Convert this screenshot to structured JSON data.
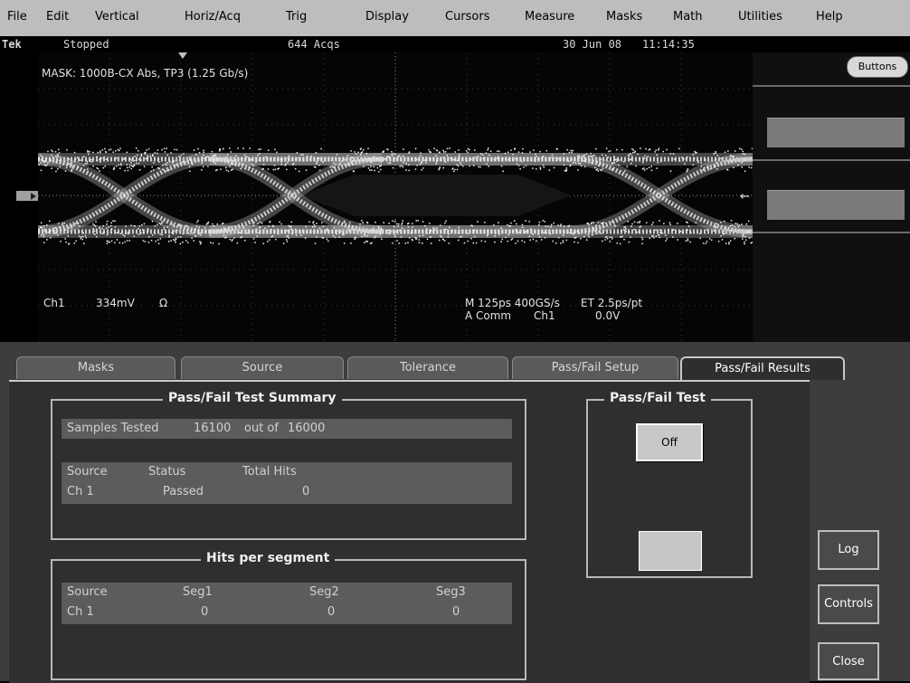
{
  "menu": {
    "items": [
      "File",
      "Edit",
      "Vertical",
      "Horiz/Acq",
      "Trig",
      "Display",
      "Cursors",
      "Measure",
      "Masks",
      "Math",
      "Utilities",
      "Help"
    ]
  },
  "status": {
    "brand": "Tek",
    "state": "Stopped",
    "acqs": "644 Acqs",
    "date": "30 Jun 08",
    "time": "11:14:35"
  },
  "scope": {
    "mask_label": "MASK: 1000B-CX Abs, TP3 (1.25 Gb/s)",
    "ch1_label": "Ch1",
    "ch1_scale": "334mV",
    "ch1_unit": "Ω",
    "horiz": "M 125ps 400GS/s",
    "record": "ET 2.5ps/pt",
    "trig_mode": "A  Comm",
    "trig_src": "Ch1",
    "trig_level": "0.0V"
  },
  "side": {
    "buttons_label": "Buttons"
  },
  "tabs": [
    {
      "label": "Masks",
      "active": false
    },
    {
      "label": "Source",
      "active": false
    },
    {
      "label": "Tolerance",
      "active": false
    },
    {
      "label": "Pass/Fail Setup",
      "active": false
    },
    {
      "label": "Pass/Fail Results",
      "active": true
    }
  ],
  "summary": {
    "title": "Pass/Fail Test Summary",
    "samples_label": "Samples Tested",
    "samples_value": "16100",
    "out_of": "out of",
    "samples_total": "16000",
    "col_source": "Source",
    "col_status": "Status",
    "col_hits": "Total Hits",
    "row_source": "Ch 1",
    "row_status": "Passed",
    "row_hits": "0"
  },
  "segments": {
    "title": "Hits per segment",
    "col_source": "Source",
    "col_seg1": "Seg1",
    "col_seg2": "Seg2",
    "col_seg3": "Seg3",
    "row_source": "Ch 1",
    "row_seg1": "0",
    "row_seg2": "0",
    "row_seg3": "0"
  },
  "test": {
    "title": "Pass/Fail Test",
    "off_label": "Off"
  },
  "buttons": {
    "log": "Log",
    "controls": "Controls",
    "close": "Close"
  }
}
